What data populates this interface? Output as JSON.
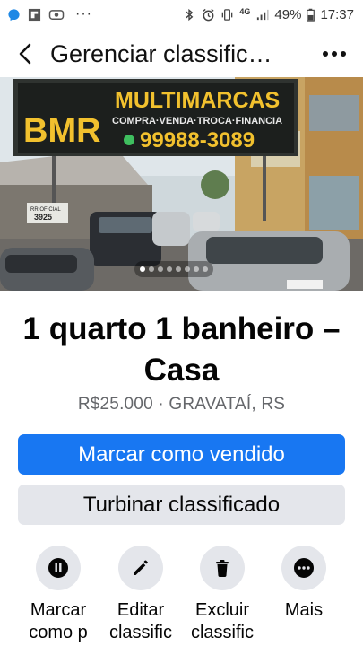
{
  "status_bar": {
    "network": "4G",
    "battery": "49%",
    "time": "17:37",
    "icons": [
      "messenger-icon",
      "flipboard-icon",
      "photo-icon",
      "more-dots-icon",
      "bluetooth-icon",
      "alarm-icon",
      "vibrate-icon",
      "signal-icon",
      "battery-icon"
    ]
  },
  "header": {
    "title": "Gerenciar classific…",
    "back_icon": "chevron-left-icon",
    "more_icon": "more-horizontal-icon"
  },
  "photo": {
    "sign_brand": "BMR",
    "sign_title": "MULTIMARCAS",
    "sign_subtitle": "COMPRA·VENDA·TROCA·FINANCIA",
    "sign_phone": "99988-3089",
    "plate_text": "RR OFICIAL",
    "plate_number": "3925",
    "image_count": 8,
    "active_index": 0
  },
  "listing": {
    "title": "1 quarto 1 banheiro – Casa",
    "price": "R$25.000",
    "separator": "·",
    "location": "GRAVATAÍ, RS"
  },
  "buttons": {
    "mark_sold": "Marcar como vendido",
    "boost": "Turbinar classificado"
  },
  "actions": [
    {
      "label": "Marcar como p",
      "icon": "pause-icon"
    },
    {
      "label": "Editar classific",
      "icon": "pencil-icon"
    },
    {
      "label": "Excluir classific",
      "icon": "trash-icon"
    },
    {
      "label": "Mais",
      "icon": "more-circle-icon"
    }
  ],
  "colors": {
    "primary": "#1877f2",
    "secondary_bg": "#e4e6eb",
    "meta_text": "#65676b"
  }
}
